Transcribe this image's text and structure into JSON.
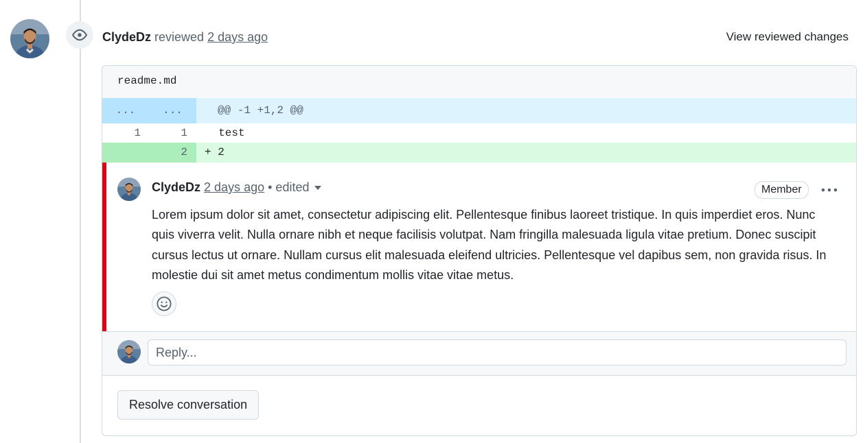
{
  "review": {
    "author": "ClydeDz",
    "action": "reviewed",
    "time": "2 days ago",
    "view_changes_label": "View reviewed changes"
  },
  "diff": {
    "file_name": "readme.md",
    "hunk": {
      "left_num": "...",
      "right_num": "...",
      "header": "@@ -1 +1,2 @@"
    },
    "lines": [
      {
        "type": "context",
        "old_num": "1",
        "new_num": "1",
        "text": "  test"
      },
      {
        "type": "addition",
        "old_num": "",
        "new_num": "2",
        "text": "+ 2"
      }
    ]
  },
  "comment": {
    "author": "ClydeDz",
    "time": "2 days ago",
    "edited": "• edited",
    "badge": "Member",
    "body": "Lorem ipsum dolor sit amet, consectetur adipiscing elit. Pellentesque finibus laoreet tristique. In quis imperdiet eros. Nunc quis viverra velit. Nulla ornare nibh et neque facilisis volutpat. Nam fringilla malesuada ligula vitae pretium. Donec suscipit cursus lectus ut ornare. Nullam cursus elit malesuada eleifend ultricies. Pellentesque vel dapibus sem, non gravida risus. In molestie dui sit amet metus condimentum mollis vitae vitae metus."
  },
  "reply": {
    "placeholder": "Reply..."
  },
  "resolve_label": "Resolve conversation",
  "colors": {
    "thread_bar": "#e3000f",
    "hunk_bg": "#ddf4ff",
    "addition_bg": "#dafbe1",
    "addition_gutter": "#aceebb"
  },
  "icons": {
    "review": "eye-icon",
    "reaction": "smiley-icon",
    "menu": "kebab-horizontal-icon"
  }
}
